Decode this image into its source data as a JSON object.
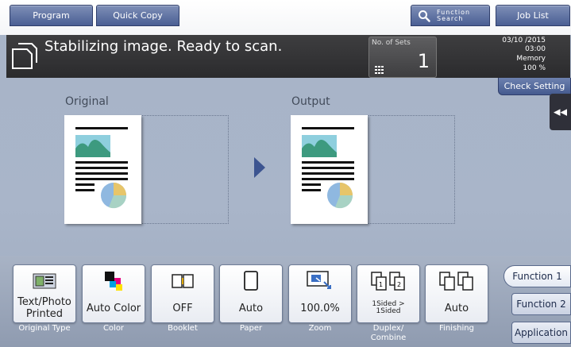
{
  "header": {
    "program_label": "Program",
    "quick_copy_label": "Quick Copy",
    "function_search_line1": "Function",
    "function_search_line2": "Search",
    "job_list_label": "Job List"
  },
  "status": {
    "message": "Stabilizing image. Ready to scan.",
    "sets_label": "No. of Sets",
    "sets_value": "1",
    "date": "03/10 /2015",
    "time": "03:00",
    "memory_label": "Memory",
    "memory_value": "100 %",
    "check_setting_label": "Check Setting"
  },
  "preview": {
    "original_label": "Original",
    "output_label": "Output"
  },
  "functions": [
    {
      "value": "Text/Photo\nPrinted",
      "caption": "Original Type"
    },
    {
      "value": "Auto Color",
      "caption": "Color"
    },
    {
      "value": "OFF",
      "caption": "Booklet"
    },
    {
      "value": "Auto",
      "caption": "Paper"
    },
    {
      "value": "100.0%",
      "caption": "Zoom"
    },
    {
      "value": "1Sided >\n1Sided",
      "caption": "Duplex/\nCombine"
    },
    {
      "value": "Auto",
      "caption": "Finishing"
    }
  ],
  "side_menu": {
    "function1": "Function 1",
    "function2": "Function 2",
    "application": "Application"
  },
  "colors": {
    "accent": "#4b5f94",
    "status_bar": "#2b2b2d",
    "background": "#a9b5c9"
  }
}
